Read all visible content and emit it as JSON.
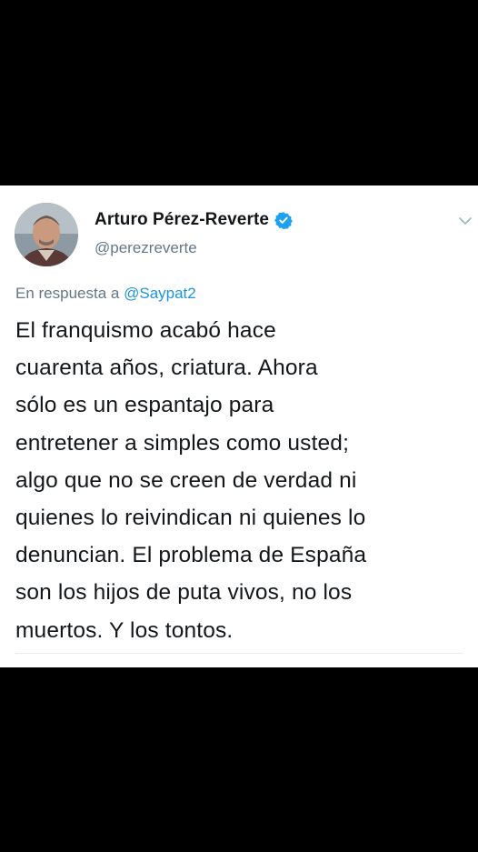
{
  "tweet": {
    "author": {
      "display_name": "Arturo Pérez-Reverte",
      "handle": "@perezreverte",
      "verified_icon": "verified-badge-icon",
      "verified_color": "#1da1f2"
    },
    "reply_context": {
      "prefix": "En respuesta a",
      "mention": "@Saypat2",
      "mention_color": "#1b95e0"
    },
    "text_lines": [
      "El franquismo acabó hace",
      "cuarenta años, criatura. Ahora",
      "sólo es un espantajo para",
      "entretener a simples como usted;",
      "algo que no se creen de verdad ni",
      "quienes lo reivindican ni quienes lo",
      "denuncian. El problema de España",
      "son los hijos de puta vivos, no los",
      "muertos. Y los tontos."
    ],
    "menu_icon": "chevron-down-icon"
  }
}
